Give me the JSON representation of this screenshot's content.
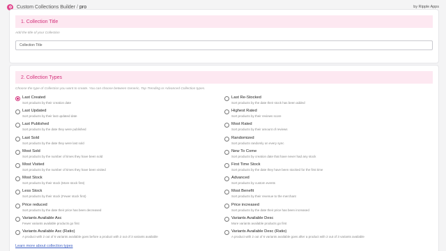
{
  "app": {
    "name": "Custom Collections Builder",
    "separator": "/",
    "plan": "pro",
    "byline": "by Ripple Apps"
  },
  "section1": {
    "title": "1. Collection Title",
    "hint": "Add the title of your Collection",
    "input_placeholder": "Collection Title",
    "input_value": ""
  },
  "section2": {
    "title": "2. Collection Types",
    "hint": "Choose the type of Collection you want to create. You can choose between Generic, Top Trending or Advanced Collection types.",
    "left": [
      {
        "label": "Last Created",
        "desc": "Sort products by their creation date",
        "selected": true
      },
      {
        "label": "Last Updated",
        "desc": "Sort products by their last updated date"
      },
      {
        "label": "Last Published",
        "desc": "Sort products by the date they were published"
      },
      {
        "label": "Last Sold",
        "desc": "Sort products by the date they were last sold"
      },
      {
        "label": "Most Sold",
        "desc": "Sort products by the number of times they have been sold"
      },
      {
        "label": "Most Visited",
        "desc": "Sort products by the number of times they have been visited"
      },
      {
        "label": "Most Stock",
        "desc": "Sort products by their stock (More stock first)"
      },
      {
        "label": "Less Stock",
        "desc": "Sort products by their stock (Fewer stock first)"
      },
      {
        "label": "Price reduced",
        "desc": "Sort products by the date their price has been decreased"
      },
      {
        "label": "Variants Available Asc",
        "desc": "Fewer variants available products go first"
      },
      {
        "label": "Variants Available Asc (Ratio)",
        "desc": "A product with 2 out of 6 variants available goes before a product with 2 out of 3 variants available"
      }
    ],
    "right": [
      {
        "label": "Last Re-Stocked",
        "desc": "Sort products by the date their stock has been added"
      },
      {
        "label": "Highest Rated",
        "desc": "Sort products by their reviews score"
      },
      {
        "label": "Most Rated",
        "desc": "Sort products by their amount of reviews"
      },
      {
        "label": "Randomized",
        "desc": "Sort products randomly on every sync"
      },
      {
        "label": "New To Come",
        "desc": "Sort products by creation date that have never had any stock"
      },
      {
        "label": "First Time Stock",
        "desc": "Sort products by the date they have been stocked for the first time"
      },
      {
        "label": "Advanced",
        "desc": "Sort products by custom events"
      },
      {
        "label": "Most Benefit",
        "desc": "Sort products by their revenue to the merchant"
      },
      {
        "label": "Price increased",
        "desc": "Sort products by the date their price has been increased"
      },
      {
        "label": "Variants Available Desc",
        "desc": "More variants available products go first"
      },
      {
        "label": "Variants Available Desc (Ratio)",
        "desc": "A product with 2 out of 6 variants available goes after a product with 2 out of 3 variants available"
      }
    ],
    "learn_more": "Learn more about collection types"
  },
  "colors": {
    "accent": "#d3307a",
    "section_header_bg": "#fde8f1",
    "link": "#3d5fc4"
  }
}
